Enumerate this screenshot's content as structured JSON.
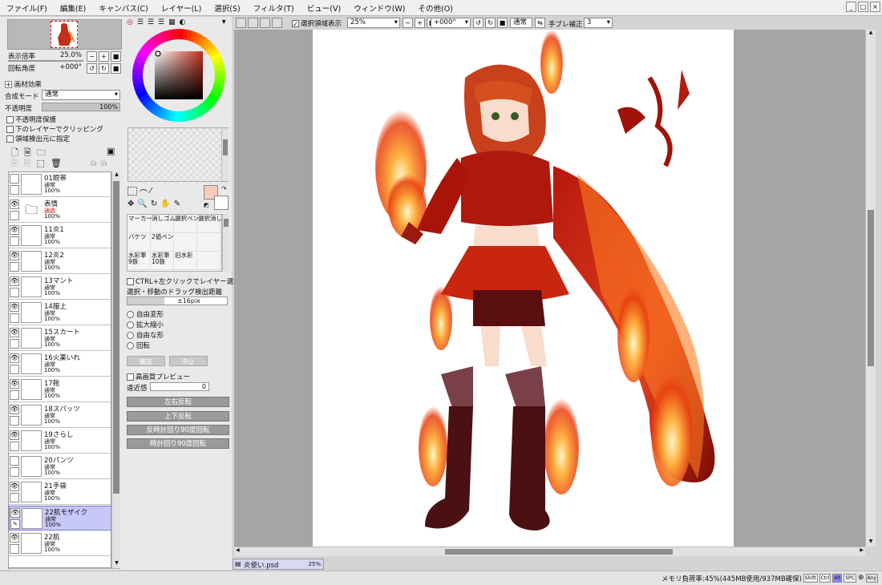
{
  "menu": [
    "ファイル(F)",
    "編集(E)",
    "キャンバス(C)",
    "レイヤー(L)",
    "選択(S)",
    "フィルタ(T)",
    "ビュー(V)",
    "ウィンドウ(W)",
    "その他(O)"
  ],
  "navigator": {
    "zoom_label": "表示倍率",
    "zoom_value": "25.0%",
    "angle_label": "回転角度",
    "angle_value": "+000°"
  },
  "paper_effect": {
    "header": "画材効果",
    "blend_label": "合成モード",
    "blend_value": "通常",
    "opacity_label": "不透明度",
    "opacity_value": "100%",
    "opacity_level": 1.0,
    "check_preserve": "不透明度保護",
    "check_clip": "下のレイヤーでクリッピング",
    "check_source": "領域検出元に指定"
  },
  "layers": [
    {
      "name": "01眼帯",
      "mode": "通常",
      "opacity": "100%",
      "visible": false,
      "folder": false,
      "active": false
    },
    {
      "name": "表情",
      "mode": "通過",
      "opacity": "100%",
      "visible": true,
      "folder": true,
      "active": false
    },
    {
      "name": "11炎1",
      "mode": "通常",
      "opacity": "100%",
      "visible": true,
      "folder": false,
      "active": false
    },
    {
      "name": "12炎2",
      "mode": "通常",
      "opacity": "100%",
      "visible": true,
      "folder": false,
      "active": false
    },
    {
      "name": "13マント",
      "mode": "通常",
      "opacity": "100%",
      "visible": true,
      "folder": false,
      "active": false
    },
    {
      "name": "14服上",
      "mode": "通常",
      "opacity": "100%",
      "visible": true,
      "folder": false,
      "active": false
    },
    {
      "name": "15スカート",
      "mode": "通常",
      "opacity": "100%",
      "visible": true,
      "folder": false,
      "active": false
    },
    {
      "name": "16火薬いれ",
      "mode": "通常",
      "opacity": "100%",
      "visible": true,
      "folder": false,
      "active": false
    },
    {
      "name": "17靴",
      "mode": "通常",
      "opacity": "100%",
      "visible": true,
      "folder": false,
      "active": false
    },
    {
      "name": "18スパッツ",
      "mode": "通常",
      "opacity": "100%",
      "visible": true,
      "folder": false,
      "active": false
    },
    {
      "name": "19さらし",
      "mode": "通常",
      "opacity": "100%",
      "visible": true,
      "folder": false,
      "active": false
    },
    {
      "name": "20パンツ",
      "mode": "通常",
      "opacity": "100%",
      "visible": false,
      "folder": false,
      "active": false
    },
    {
      "name": "21手袋",
      "mode": "通常",
      "opacity": "100%",
      "visible": true,
      "folder": false,
      "active": false
    },
    {
      "name": "22肌モザイク",
      "mode": "通常",
      "opacity": "100%",
      "visible": true,
      "folder": false,
      "active": true
    },
    {
      "name": "22肌",
      "mode": "通常",
      "opacity": "100%",
      "visible": true,
      "folder": false,
      "active": false
    }
  ],
  "tools": {
    "brush_grid": [
      [
        "マーカー",
        "消しゴム",
        "選択ペン",
        "選択消し"
      ],
      [
        "バケツ",
        "2値ペン",
        "",
        ""
      ],
      [
        "水彩筆\n9鉄",
        "水彩筆\n10鉄",
        "旧水彩",
        ""
      ]
    ],
    "ctrl_click": "CTRL+左クリックでレイヤー選択",
    "drag_distance": "選択・移動のドラッグ検出距離",
    "drag_value": "±16pix",
    "transform_options": [
      "自由変形",
      "拡大縮小",
      "自由な形",
      "回転"
    ],
    "confirm": "確定",
    "cancel": "中止",
    "hq_preview": "高画質プレビュー",
    "perspective_label": "遠近感",
    "perspective_value": "0",
    "flip_h": "左右反転",
    "flip_v": "上下反転",
    "rot_ccw": "反時計回り90度回転",
    "rot_cw": "時計回り90度回転"
  },
  "toolbar": {
    "selection_toggle": "選択領域表示",
    "zoom": "25%",
    "angle": "+000°",
    "mode": "通常",
    "stabilizer_label": "手ブレ補正",
    "stabilizer_value": "3"
  },
  "document_tab": {
    "name": "炎使い.psd",
    "zoom": "25%"
  },
  "status": {
    "memory": "メモリ負荷率:45%(445MB使用/937MB確保)",
    "keys": [
      "Shift",
      "Ctrl",
      "Alt",
      "SPC"
    ],
    "any": "Any"
  },
  "colors": {
    "main": "#f5cdb8",
    "sub": "#ffffff",
    "picker_base": "#c0301c"
  }
}
